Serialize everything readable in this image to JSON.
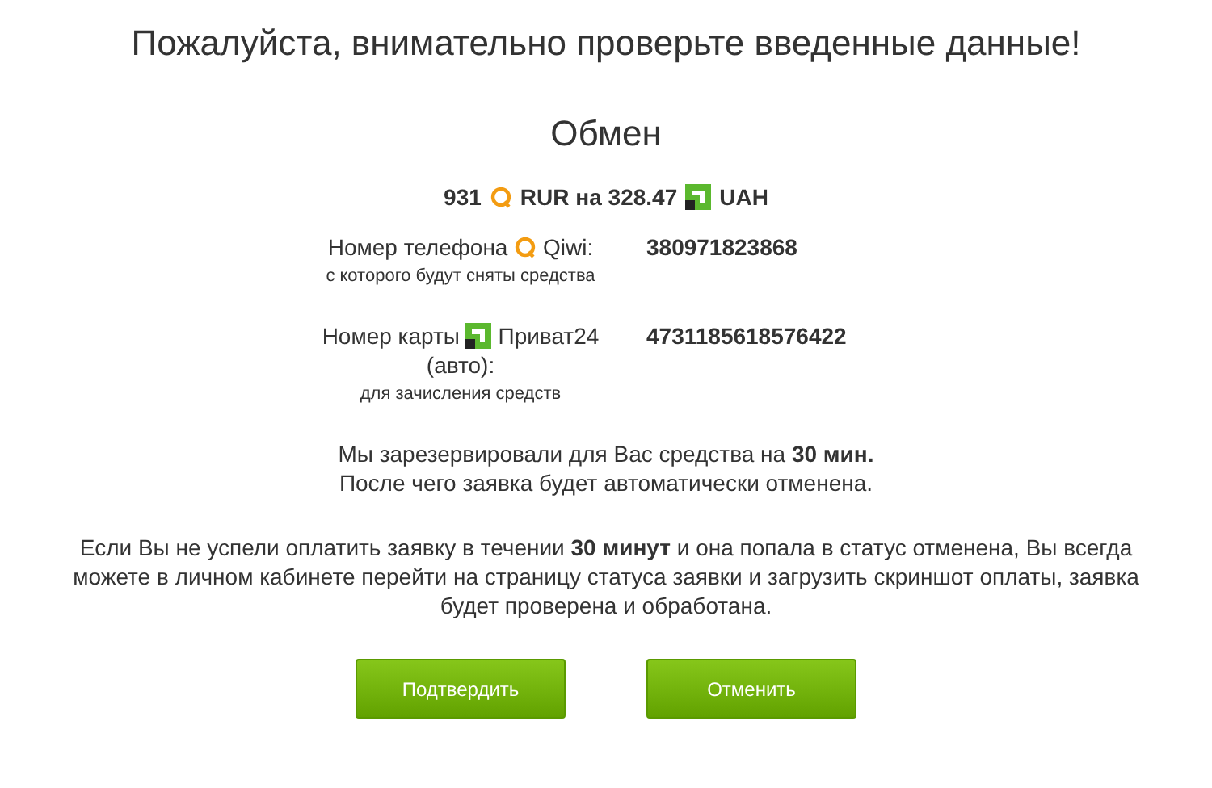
{
  "heading": "Пожалуйста, внимательно проверьте введенные данные!",
  "title": "Обмен",
  "exchange": {
    "give_amount": "931",
    "give_currency": "RUR",
    "connector": "на",
    "get_amount": "328.47",
    "get_currency": "UAH"
  },
  "fields": [
    {
      "kind": "qiwi",
      "label_before": "Номер телефона",
      "label_after": "Qiwi:",
      "hint": "с которого будут сняты средства",
      "value": "380971823868"
    },
    {
      "kind": "privat",
      "label_before": "Номер карты",
      "label_after": "Приват24 (авто):",
      "hint": "для зачисления средств",
      "value": "4731185618576422"
    }
  ],
  "reserve_note": "Мы зарезервировали для Вас средства на **30 мин.**\nПосле чего заявка будет автоматически отменена.",
  "info_note": "Если Вы не успели оплатить заявку в течении **30 минут** и она попала в статус отменена, Вы всегда можете в личном кабинете перейти на страницу статуса заявки и загрузить скриншот оплаты, заявка будет проверена и обработана.",
  "buttons": [
    "Подтвердить",
    "Отменить"
  ]
}
